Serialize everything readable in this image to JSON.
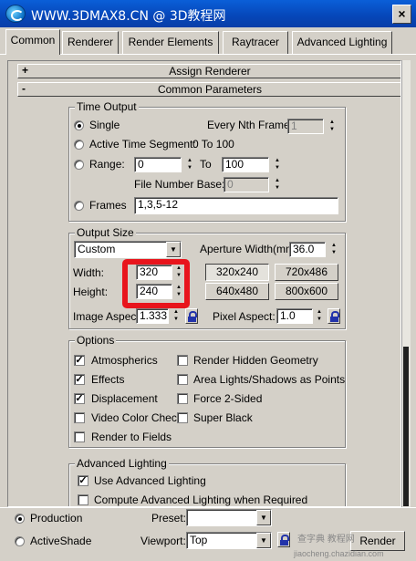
{
  "window": {
    "title": "WWW.3DMAX8.CN @ 3D教程网",
    "close_label": "×"
  },
  "tabs": [
    {
      "label": "Common",
      "active": true
    },
    {
      "label": "Renderer",
      "active": false
    },
    {
      "label": "Render Elements",
      "active": false
    },
    {
      "label": "Raytracer",
      "active": false
    },
    {
      "label": "Advanced Lighting",
      "active": false
    }
  ],
  "rollouts": {
    "assign": {
      "sign": "+",
      "label": "Assign Renderer"
    },
    "common": {
      "sign": "-",
      "label": "Common Parameters"
    }
  },
  "time_output": {
    "title": "Time Output",
    "single": "Single",
    "every_nth": "Every Nth Frame:",
    "every_nth_value": "1",
    "active_segment": "Active Time Segment:",
    "active_segment_value": "0 To 100",
    "range": "Range:",
    "range_from": "0",
    "range_to_label": "To",
    "range_to": "100",
    "file_number_base": "File Number Base:",
    "file_number_base_value": "0",
    "frames": "Frames",
    "frames_value": "1,3,5-12"
  },
  "output_size": {
    "title": "Output Size",
    "preset": "Custom",
    "aperture_label": "Aperture Width(mm):",
    "aperture_value": "36.0",
    "width_label": "Width:",
    "width_value": "320",
    "height_label": "Height:",
    "height_value": "240",
    "presets": [
      "320x240",
      "720x486",
      "640x480",
      "800x600"
    ],
    "image_aspect_label": "Image Aspect:",
    "image_aspect_value": "1.333",
    "pixel_aspect_label": "Pixel Aspect:",
    "pixel_aspect_value": "1.0"
  },
  "options": {
    "title": "Options",
    "atmospherics": "Atmospherics",
    "effects": "Effects",
    "displacement": "Displacement",
    "video_color_check": "Video Color Check",
    "render_to_fields": "Render to Fields",
    "render_hidden": "Render Hidden Geometry",
    "area_lights": "Area Lights/Shadows as Points",
    "force_2sided": "Force 2-Sided",
    "super_black": "Super Black",
    "check_mark": "✓"
  },
  "advanced_lighting": {
    "title": "Advanced Lighting",
    "use": "Use Advanced Lighting",
    "compute": "Compute Advanced Lighting when Required"
  },
  "bottom": {
    "production": "Production",
    "activeshade": "ActiveShade",
    "preset_label": "Preset:",
    "preset_value": "",
    "viewport_label": "Viewport:",
    "viewport_value": "Top",
    "render_button": "Render",
    "watermark1": "查字典 教程网",
    "watermark2": "jiaocheng.chazidian.com"
  }
}
